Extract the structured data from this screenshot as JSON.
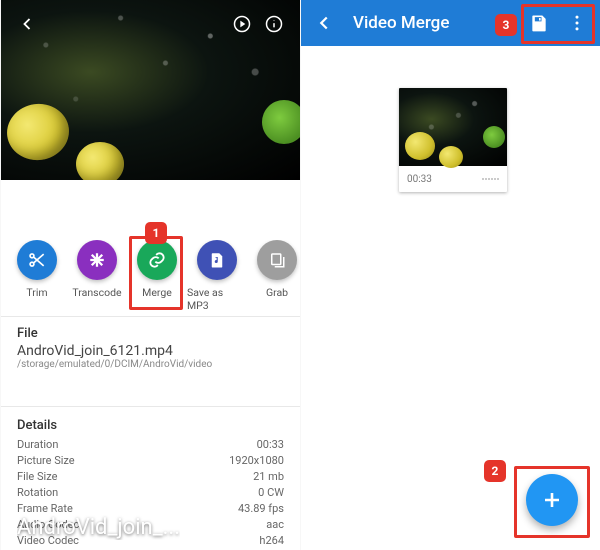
{
  "left": {
    "hero_title": "AndroVid_join_...",
    "tools": [
      {
        "id": "trim",
        "label": "Trim",
        "color": "col-blue"
      },
      {
        "id": "transcode",
        "label": "Transcode",
        "color": "col-purple"
      },
      {
        "id": "merge",
        "label": "Merge",
        "color": "col-green"
      },
      {
        "id": "saveasmp3",
        "label": "Save as MP3",
        "color": "col-indigo"
      },
      {
        "id": "grab",
        "label": "Grab",
        "color": "col-grey"
      }
    ],
    "file": {
      "heading": "File",
      "name": "AndroVid_join_6121.mp4",
      "path": "/storage/emulated/0/DCIM/AndroVid/video"
    },
    "details": {
      "heading": "Details",
      "rows": [
        {
          "k": "Duration",
          "v": "00:33"
        },
        {
          "k": "Picture Size",
          "v": "1920x1080"
        },
        {
          "k": "File Size",
          "v": "21 mb"
        },
        {
          "k": "Rotation",
          "v": "0 CW"
        },
        {
          "k": "Frame Rate",
          "v": "43.89 fps"
        },
        {
          "k": "Audio Codec",
          "v": "aac"
        },
        {
          "k": "Video Codec",
          "v": "h264"
        }
      ]
    }
  },
  "right": {
    "appbar_title": "Video Merge",
    "thumbnail_duration": "00:33"
  },
  "annotations": {
    "n1": "1",
    "n2": "2",
    "n3": "3"
  }
}
